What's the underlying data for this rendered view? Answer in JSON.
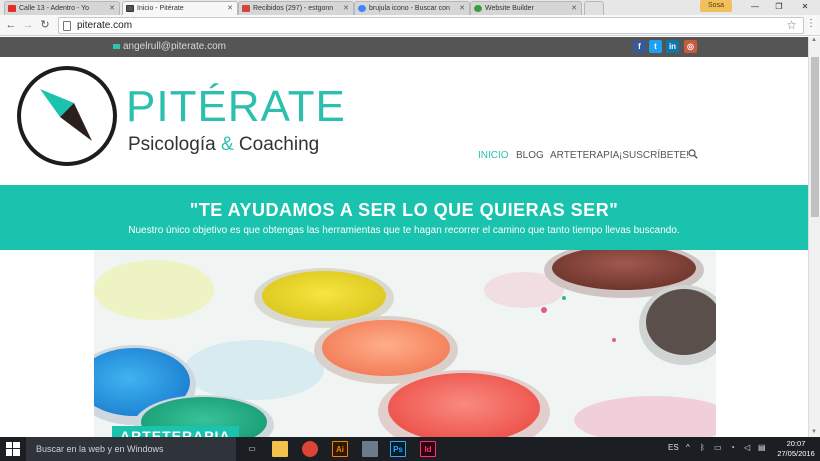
{
  "browser": {
    "tabs": [
      {
        "title": "Calle 13 - Adentro - Yo",
        "favicon_color": "#e52d27",
        "active": false
      },
      {
        "title": "Inicio - Pitérate",
        "favicon_color": "#555555",
        "active": true
      },
      {
        "title": "Recibidos (297) - estgonn",
        "favicon_color": "#d44638",
        "active": false
      },
      {
        "title": "brujula icono - Buscar con",
        "favicon_color": "#4285f4",
        "active": false
      },
      {
        "title": "Website Builder",
        "favicon_color": "#3b9c3b",
        "active": false
      }
    ],
    "user_badge": "Sosa",
    "url": "piterate.com"
  },
  "site": {
    "email": "angelrull@piterate.com",
    "social": [
      {
        "name": "facebook",
        "glyph": "f",
        "color": "#3b5998"
      },
      {
        "name": "twitter",
        "glyph": "t",
        "color": "#1da1f2"
      },
      {
        "name": "linkedin",
        "glyph": "in",
        "color": "#0e76a8"
      },
      {
        "name": "instagram",
        "glyph": "◎",
        "color": "#c75b3a"
      }
    ],
    "brand": {
      "name": "PITÉRATE",
      "tagline_a": "Psicología",
      "tagline_amp": "&",
      "tagline_b": "Coaching"
    },
    "nav": [
      {
        "label": "INICIO",
        "active": true
      },
      {
        "label": "BLOG",
        "active": false
      },
      {
        "label": "ARTETERAPIA",
        "active": false
      },
      {
        "label": "¡SUSCRÍBETE!",
        "active": false
      }
    ],
    "banner": {
      "title": "\"TE AYUDAMOS A SER LO QUE QUIERAS SER\"",
      "subtitle": "Nuestro único objetivo es que obtengas las herramientas que te hagan recorrer el camino que tanto tiempo llevas buscando."
    },
    "hero_caption": "ARTETERAPIA",
    "accent_color": "#19c3ad"
  },
  "taskbar": {
    "search_placeholder": "Buscar en la web y en Windows",
    "apps": [
      {
        "name": "file-explorer",
        "glyph": "",
        "color": "#f2c14e"
      },
      {
        "name": "chrome",
        "glyph": "",
        "color": "#db4437"
      },
      {
        "name": "illustrator",
        "glyph": "Ai",
        "color": "#ff7c00"
      },
      {
        "name": "network-app",
        "glyph": "",
        "color": "#6a7b8c"
      },
      {
        "name": "photoshop",
        "glyph": "Ps",
        "color": "#31a8ff"
      },
      {
        "name": "indesign",
        "glyph": "Id",
        "color": "#ff3366"
      }
    ],
    "language": "ES",
    "time": "20:07",
    "date": "27/05/2016"
  }
}
